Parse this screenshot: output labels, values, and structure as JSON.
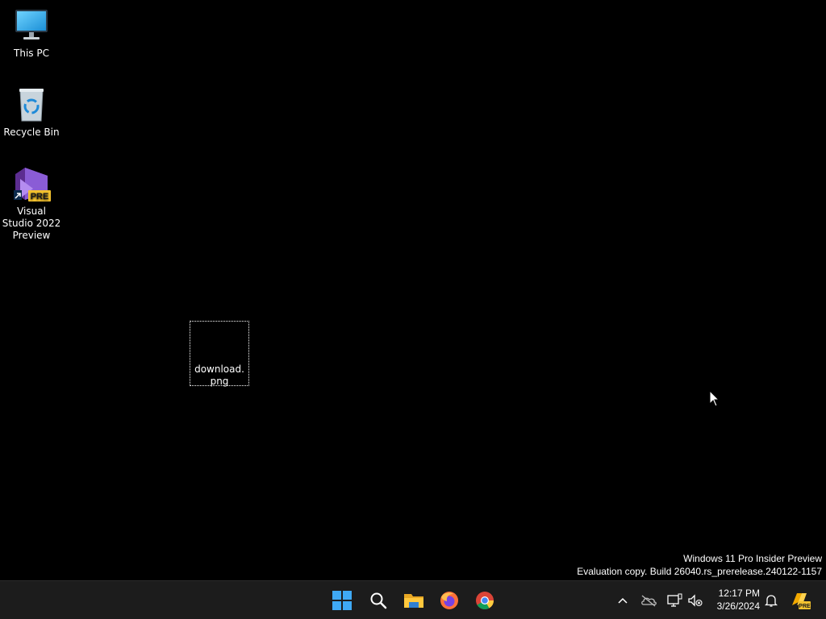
{
  "desktop": {
    "icons": [
      {
        "label": "This PC",
        "icon": "monitor-icon"
      },
      {
        "label": "Recycle Bin",
        "icon": "recycle-bin-icon"
      },
      {
        "label": "Visual Studio 2022 Preview",
        "icon": "visual-studio-preview-icon",
        "badge": "PRE"
      }
    ],
    "selected_file": {
      "label": "download.png"
    }
  },
  "watermark": {
    "line1": "Windows 11 Pro Insider Preview",
    "line2": "Evaluation copy. Build 26040.rs_prerelease.240122-1157"
  },
  "taskbar": {
    "apps": [
      {
        "name": "Start",
        "icon": "windows-start-icon"
      },
      {
        "name": "Search",
        "icon": "search-icon"
      },
      {
        "name": "File Explorer",
        "icon": "folder-icon"
      },
      {
        "name": "Firefox",
        "icon": "firefox-icon"
      },
      {
        "name": "Chrome",
        "icon": "chrome-icon"
      }
    ],
    "tray": {
      "time": "12:17 PM",
      "date": "3/26/2024",
      "copilot_badge": "PRE"
    }
  },
  "colors": {
    "desktop_bg": "#000000",
    "taskbar_bg": "#1c1c1c",
    "start_blue": "#3fa9f5",
    "vs_purple": "#8a5cd6",
    "pre_badge": "#f2c12e"
  }
}
